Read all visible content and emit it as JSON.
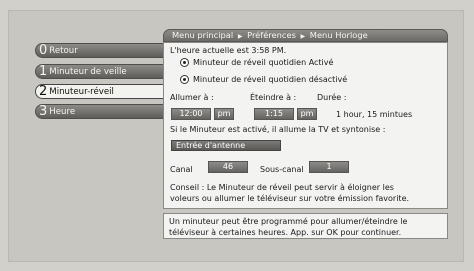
{
  "breadcrumb": {
    "items": [
      "Menu principal",
      "Préférences",
      "Menu Horloge"
    ],
    "separator": "▶"
  },
  "menu": {
    "items": [
      {
        "number": "0",
        "label": "Retour"
      },
      {
        "number": "1",
        "label": "Minuteur de veille"
      },
      {
        "number": "2",
        "label": "Minuteur-réveil",
        "selected": true
      },
      {
        "number": "3",
        "label": "Heure"
      }
    ]
  },
  "panel": {
    "current_time": "L'heure actuelle est 3:58 PM.",
    "options": [
      {
        "label": "Minuteur de réveil quotidien Activé"
      },
      {
        "label": "Minuteur de réveil quotidien désactivé"
      }
    ],
    "on_label": "Allumer à :",
    "off_label": "Éteindre à :",
    "duration_label": "Durée :",
    "on_time": "12:00",
    "on_ampm": "pm",
    "off_time": "1:15",
    "off_ampm": "pm",
    "duration_value": "1 hour, 15 mintues",
    "timer_note": "Si le Minuteur est activé, il allume la TV et syntonise :",
    "input_source": "Entrée d'antenne",
    "channel_label": "Canal",
    "channel_value": "46",
    "subchannel_label": "Sous-canal",
    "subchannel_value": "1",
    "tip_line1": "Conseil : Le Minuteur de réveil peut servir à éloigner les",
    "tip_line2": "voleurs ou allumer le téléviseur sur votre émission favorite."
  },
  "help": {
    "line1": "Un minuteur peut être programmé pour allumer/éteindre le",
    "line2": "téléviseur à certaines heures. App. sur OK pour continuer."
  }
}
